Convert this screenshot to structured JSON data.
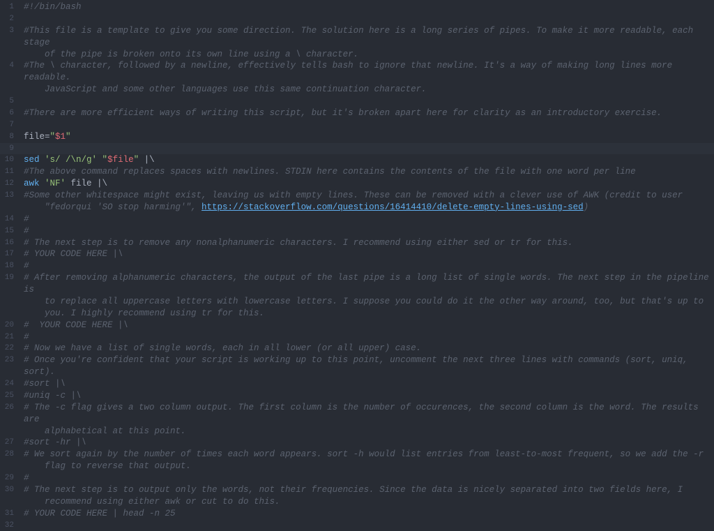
{
  "editor": {
    "highlighted_line": 9,
    "lines": [
      {
        "num": 1,
        "tokens": [
          {
            "t": "shebang",
            "v": "#!/bin/bash"
          }
        ]
      },
      {
        "num": 2,
        "tokens": []
      },
      {
        "num": 3,
        "tokens": [
          {
            "t": "comment",
            "v": "#This file is a template to give you some direction. The solution here is a long series of pipes. To make it more readable, each stage"
          }
        ],
        "wrap": [
          {
            "t": "comment",
            "v": "of the pipe is broken onto its own line using a \\ character."
          }
        ]
      },
      {
        "num": 4,
        "tokens": [
          {
            "t": "comment",
            "v": "#The \\ character, followed by a newline, effectively tells bash to ignore that newline. It's a way of making long lines more readable."
          }
        ],
        "wrap": [
          {
            "t": "comment",
            "v": "JavaScript and some other languages use this same continuation character."
          }
        ]
      },
      {
        "num": 5,
        "tokens": []
      },
      {
        "num": 6,
        "tokens": [
          {
            "t": "comment",
            "v": "#There are more efficient ways of writing this script, but it's broken apart here for clarity as an introductory exercise."
          }
        ]
      },
      {
        "num": 7,
        "tokens": []
      },
      {
        "num": 8,
        "tokens": [
          {
            "t": "plain",
            "v": "file="
          },
          {
            "t": "string-dq",
            "v": "\""
          },
          {
            "t": "var",
            "v": "$1"
          },
          {
            "t": "string-dq",
            "v": "\""
          }
        ]
      },
      {
        "num": 9,
        "tokens": [],
        "highlighted": true
      },
      {
        "num": 10,
        "tokens": [
          {
            "t": "builtin",
            "v": "sed "
          },
          {
            "t": "string-sq",
            "v": "'s/ /\\n/g'"
          },
          {
            "t": "plain",
            "v": " "
          },
          {
            "t": "string-dq",
            "v": "\""
          },
          {
            "t": "var",
            "v": "$file"
          },
          {
            "t": "string-dq",
            "v": "\""
          },
          {
            "t": "plain",
            "v": " |\\"
          }
        ]
      },
      {
        "num": 11,
        "tokens": [
          {
            "t": "comment",
            "v": "#The above command replaces spaces with newlines. STDIN here contains the contents of the file with one word per line"
          }
        ]
      },
      {
        "num": 12,
        "tokens": [
          {
            "t": "builtin",
            "v": "awk "
          },
          {
            "t": "string-sq",
            "v": "'NF'"
          },
          {
            "t": "plain",
            "v": " file |\\"
          }
        ]
      },
      {
        "num": 13,
        "tokens": [
          {
            "t": "comment",
            "v": "#Some other whitespace might exist, leaving us with empty lines. These can be removed with a clever use of AWK (credit to user"
          }
        ],
        "wrap": [
          {
            "t": "comment",
            "v": "\"fedorqui 'SO stop harming'\", "
          },
          {
            "t": "link",
            "v": "https://stackoverflow.com/questions/16414410/delete-empty-lines-using-sed"
          },
          {
            "t": "comment",
            "v": ")"
          }
        ]
      },
      {
        "num": 14,
        "tokens": [
          {
            "t": "comment",
            "v": "#"
          }
        ]
      },
      {
        "num": 15,
        "tokens": [
          {
            "t": "comment",
            "v": "#"
          }
        ]
      },
      {
        "num": 16,
        "tokens": [
          {
            "t": "comment",
            "v": "# The next step is to remove any nonalphanumeric characters. I recommend using either sed or tr for this."
          }
        ]
      },
      {
        "num": 17,
        "tokens": [
          {
            "t": "comment",
            "v": "# YOUR CODE HERE |\\"
          }
        ]
      },
      {
        "num": 18,
        "tokens": [
          {
            "t": "comment",
            "v": "#"
          }
        ]
      },
      {
        "num": 19,
        "tokens": [
          {
            "t": "comment",
            "v": "# After removing alphanumeric characters, the output of the last pipe is a long list of single words. The next step in the pipeline is"
          }
        ],
        "wrap": [
          {
            "t": "comment",
            "v": "to replace all uppercase letters with lowercase letters. I suppose you could do it the other way around, too, but that's up to"
          }
        ],
        "wrap2": [
          {
            "t": "comment",
            "v": "you. I highly recommend using tr for this."
          }
        ]
      },
      {
        "num": 20,
        "tokens": [
          {
            "t": "comment",
            "v": "#  YOUR CODE HERE |\\"
          }
        ]
      },
      {
        "num": 21,
        "tokens": [
          {
            "t": "comment",
            "v": "#"
          }
        ]
      },
      {
        "num": 22,
        "tokens": [
          {
            "t": "comment",
            "v": "# Now we have a list of single words, each in all lower (or all upper) case."
          }
        ]
      },
      {
        "num": 23,
        "tokens": [
          {
            "t": "comment",
            "v": "# Once you're confident that your script is working up to this point, uncomment the next three lines with commands (sort, uniq, sort)."
          }
        ]
      },
      {
        "num": 24,
        "tokens": [
          {
            "t": "comment",
            "v": "#sort |\\"
          }
        ]
      },
      {
        "num": 25,
        "tokens": [
          {
            "t": "comment",
            "v": "#uniq -c |\\"
          }
        ]
      },
      {
        "num": 26,
        "tokens": [
          {
            "t": "comment",
            "v": "# The -c flag gives a two column output. The first column is the number of occurences, the second column is the word. The results are"
          }
        ],
        "wrap": [
          {
            "t": "comment",
            "v": "alphabetical at this point."
          }
        ]
      },
      {
        "num": 27,
        "tokens": [
          {
            "t": "comment",
            "v": "#sort -hr |\\"
          }
        ]
      },
      {
        "num": 28,
        "tokens": [
          {
            "t": "comment",
            "v": "# We sort again by the number of times each word appears. sort -h would list entries from least-to-most frequent, so we add the -r"
          }
        ],
        "wrap": [
          {
            "t": "comment",
            "v": "flag to reverse that output."
          }
        ]
      },
      {
        "num": 29,
        "tokens": [
          {
            "t": "comment",
            "v": "#"
          }
        ]
      },
      {
        "num": 30,
        "tokens": [
          {
            "t": "comment",
            "v": "# The next step is to output only the words, not their frequencies. Since the data is nicely separated into two fields here, I"
          }
        ],
        "wrap": [
          {
            "t": "comment",
            "v": "recommend using either awk or cut to do this."
          }
        ]
      },
      {
        "num": 31,
        "tokens": [
          {
            "t": "comment",
            "v": "# YOUR CODE HERE | head -n 25"
          }
        ]
      },
      {
        "num": 32,
        "tokens": []
      }
    ]
  }
}
